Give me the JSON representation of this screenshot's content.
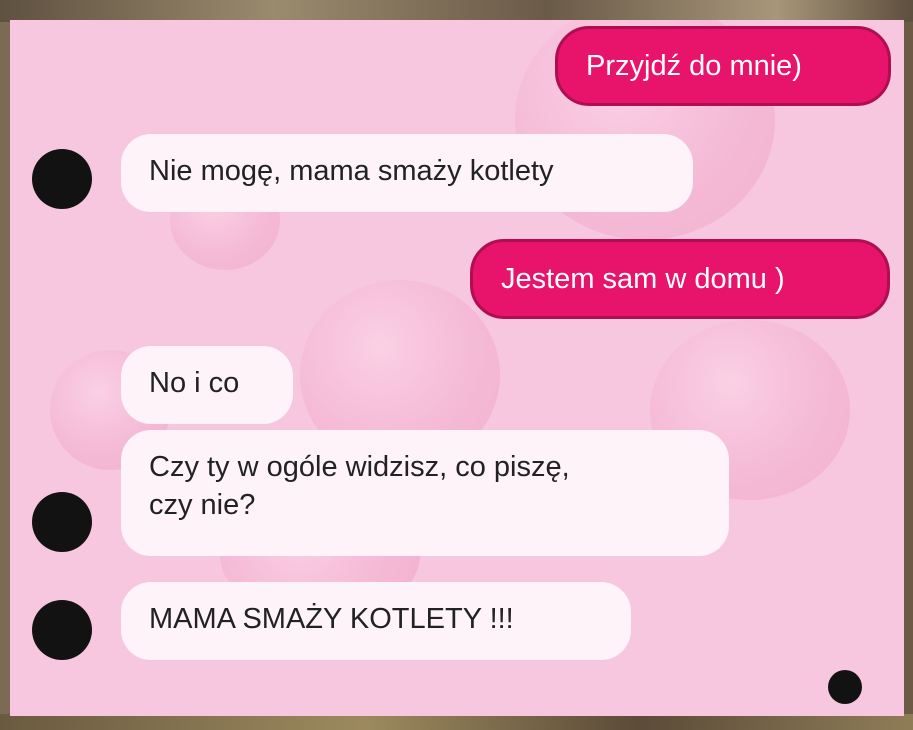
{
  "colors": {
    "chat_background": "#f7c6df",
    "incoming_bubble": "#fdf3f8",
    "outgoing_bubble": "#e8146b",
    "avatar": "#121212"
  },
  "messages": [
    {
      "direction": "outgoing",
      "text": "Przyjdź do mnie)"
    },
    {
      "direction": "incoming",
      "text": "Nie mogę, mama smaży kotlety"
    },
    {
      "direction": "outgoing",
      "text": "Jestem sam w domu )"
    },
    {
      "direction": "incoming",
      "text": "No i co"
    },
    {
      "direction": "incoming",
      "text": "Czy ty w ogóle widzisz, co piszę,\nczy nie?"
    },
    {
      "direction": "incoming",
      "text": "MAMA SMAŻY KOTLETY !!!"
    }
  ]
}
